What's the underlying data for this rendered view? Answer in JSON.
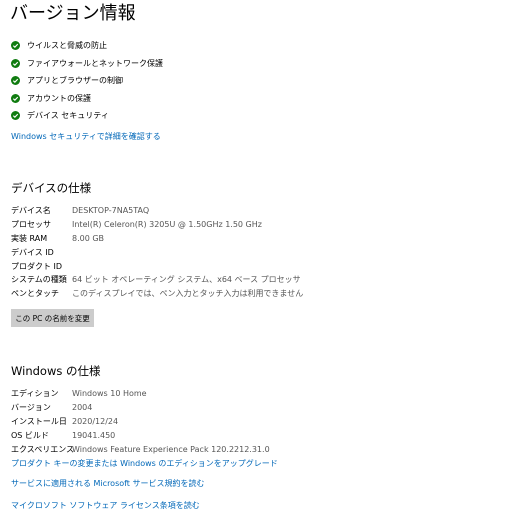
{
  "page": {
    "title": "バージョン情報"
  },
  "security": {
    "items": [
      {
        "label": "ウイルスと脅威の防止"
      },
      {
        "label": "ファイアウォールとネットワーク保護"
      },
      {
        "label": "アプリとブラウザーの制御"
      },
      {
        "label": "アカウントの保護"
      },
      {
        "label": "デバイス セキュリティ"
      }
    ],
    "link": "Windows セキュリティで詳細を確認する",
    "check_color": "#107c10"
  },
  "device_spec": {
    "title": "デバイスの仕様",
    "rows": [
      {
        "key": "デバイス名",
        "value": "DESKTOP-7NA5TAQ"
      },
      {
        "key": "プロセッサ",
        "value": "Intel(R) Celeron(R) 3205U @ 1.50GHz   1.50 GHz"
      },
      {
        "key": "実装 RAM",
        "value": "8.00 GB"
      },
      {
        "key": "デバイス ID",
        "value": ""
      },
      {
        "key": "プロダクト ID",
        "value": ""
      },
      {
        "key": "システムの種類",
        "value": "64 ビット オペレーティング システム、x64 ベース プロセッサ"
      },
      {
        "key": "ペンとタッチ",
        "value": "このディスプレイでは、ペン入力とタッチ入力は利用できません"
      }
    ],
    "rename_button": "この PC の名前を変更"
  },
  "windows_spec": {
    "title": "Windows の仕様",
    "rows": [
      {
        "key": "エディション",
        "value": "Windows 10 Home"
      },
      {
        "key": "バージョン",
        "value": "2004"
      },
      {
        "key": "インストール日",
        "value": "2020/12/24"
      },
      {
        "key": "OS ビルド",
        "value": "19041.450"
      },
      {
        "key": "エクスペリエンス",
        "value": "Windows Feature Experience Pack 120.2212.31.0"
      }
    ],
    "links": {
      "change_key": "プロダクト キーの変更または Windows のエディションをアップグレード",
      "service_agreement": "サービスに適用される Microsoft サービス規約を読む",
      "license_terms": "マイクロソフト ソフトウェア ライセンス条項を読む"
    }
  },
  "colors": {
    "link": "#0067b8",
    "button_bg": "#cccccc"
  }
}
